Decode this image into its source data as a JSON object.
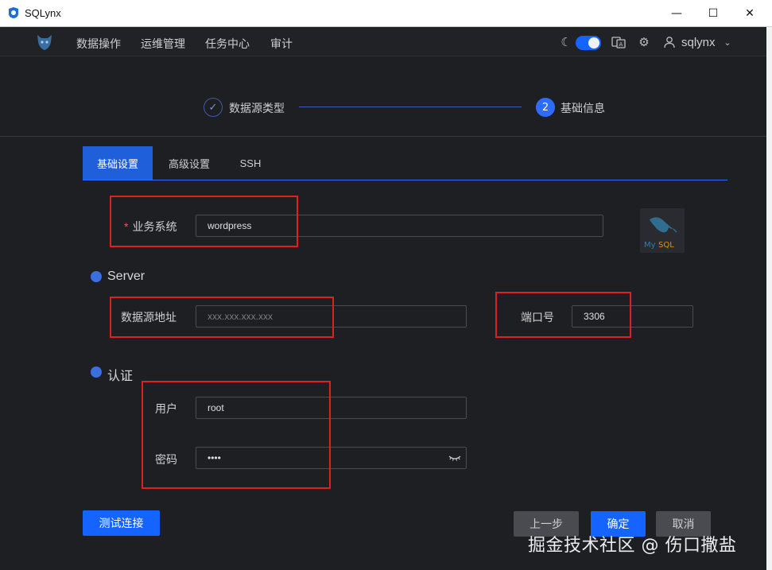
{
  "window": {
    "title": "SQLynx",
    "min_icon": "—",
    "max_icon": "☐",
    "close_icon": "✕"
  },
  "header": {
    "menu": [
      "数据操作",
      "运维管理",
      "任务中心",
      "审计"
    ],
    "username": "sqlynx",
    "icons": [
      "moon-icon",
      "theme-toggle",
      "translate-icon",
      "gear-icon",
      "user-icon",
      "chevron-down-icon"
    ]
  },
  "steps": [
    {
      "label": "数据源类型",
      "marker": "✓"
    },
    {
      "label": "基础信息",
      "marker": "2"
    }
  ],
  "tabs": [
    "基础设置",
    "高级设置",
    "SSH"
  ],
  "form": {
    "business_system": {
      "label": "业务系统",
      "required_mark": "*",
      "value": "wordpress"
    },
    "server_section": "Server",
    "address": {
      "label": "数据源地址",
      "placeholder": "xxx.xxx.xxx.xxx"
    },
    "port": {
      "label": "端口号",
      "value": "3306"
    },
    "auth_section": "认证",
    "user": {
      "label": "用户",
      "value": "root"
    },
    "password": {
      "label": "密码",
      "value": "••••"
    }
  },
  "buttons": {
    "test": "测试连接",
    "prev": "上一步",
    "ok": "确定",
    "cancel": "取消"
  },
  "colors": {
    "accent": "#1664ff",
    "highlight_box": "#e02020",
    "background": "#1e1f22"
  },
  "watermark": "掘金技术社区 @ 伤口撒盐"
}
